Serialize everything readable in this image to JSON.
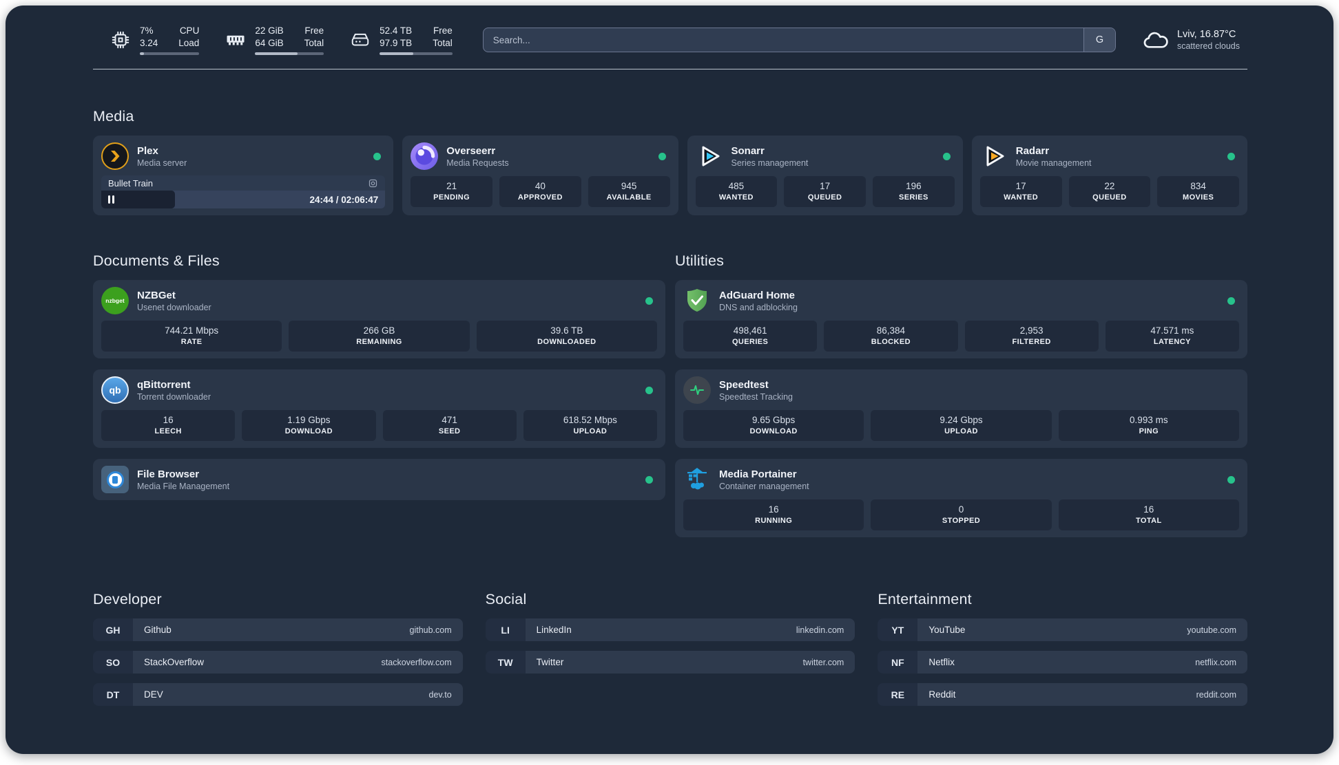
{
  "system": {
    "cpu": {
      "value_top": "7%",
      "value_bottom": "3.24",
      "label_top": "CPU",
      "label_bottom": "Load",
      "progress_pct": 7
    },
    "memory": {
      "value_top": "22 GiB",
      "value_bottom": "64 GiB",
      "label_top": "Free",
      "label_bottom": "Total",
      "progress_pct": 62
    },
    "disk": {
      "value_top": "52.4 TB",
      "value_bottom": "97.9 TB",
      "label_top": "Free",
      "label_bottom": "Total",
      "progress_pct": 46
    }
  },
  "search": {
    "placeholder": "Search...",
    "engine_button": "G"
  },
  "weather": {
    "location": "Lviv, 16.87°C",
    "condition": "scattered clouds"
  },
  "colors": {
    "online_dot": "#27c28b"
  },
  "sections": {
    "media": {
      "title": "Media",
      "plex": {
        "name": "Plex",
        "subtitle": "Media server",
        "icon": "plex-icon",
        "now_playing": {
          "title": "Bullet Train",
          "time_display": "24:44 / 02:06:47",
          "progress_pct": 26
        }
      },
      "overseerr": {
        "name": "Overseerr",
        "subtitle": "Media Requests",
        "icon": "overseerr-icon",
        "stats": [
          {
            "value": "21",
            "label": "PENDING"
          },
          {
            "value": "40",
            "label": "APPROVED"
          },
          {
            "value": "945",
            "label": "AVAILABLE"
          }
        ]
      },
      "sonarr": {
        "name": "Sonarr",
        "subtitle": "Series management",
        "icon": "sonarr-icon",
        "stats": [
          {
            "value": "485",
            "label": "WANTED"
          },
          {
            "value": "17",
            "label": "QUEUED"
          },
          {
            "value": "196",
            "label": "SERIES"
          }
        ]
      },
      "radarr": {
        "name": "Radarr",
        "subtitle": "Movie management",
        "icon": "radarr-icon",
        "stats": [
          {
            "value": "17",
            "label": "WANTED"
          },
          {
            "value": "22",
            "label": "QUEUED"
          },
          {
            "value": "834",
            "label": "MOVIES"
          }
        ]
      }
    },
    "documents": {
      "title": "Documents & Files",
      "nzbget": {
        "name": "NZBGet",
        "subtitle": "Usenet downloader",
        "icon": "nzbget-icon",
        "stats": [
          {
            "value": "744.21 Mbps",
            "label": "RATE"
          },
          {
            "value": "266 GB",
            "label": "REMAINING"
          },
          {
            "value": "39.6 TB",
            "label": "DOWNLOADED"
          }
        ]
      },
      "qbittorrent": {
        "name": "qBittorrent",
        "subtitle": "Torrent downloader",
        "icon": "qbittorrent-icon",
        "stats": [
          {
            "value": "16",
            "label": "LEECH"
          },
          {
            "value": "1.19 Gbps",
            "label": "DOWNLOAD"
          },
          {
            "value": "471",
            "label": "SEED"
          },
          {
            "value": "618.52 Mbps",
            "label": "UPLOAD"
          }
        ]
      },
      "filebrowser": {
        "name": "File Browser",
        "subtitle": "Media File Management",
        "icon": "filebrowser-icon"
      }
    },
    "utilities": {
      "title": "Utilities",
      "adguard": {
        "name": "AdGuard Home",
        "subtitle": "DNS and adblocking",
        "icon": "adguard-icon",
        "stats": [
          {
            "value": "498,461",
            "label": "QUERIES"
          },
          {
            "value": "86,384",
            "label": "BLOCKED"
          },
          {
            "value": "2,953",
            "label": "FILTERED"
          },
          {
            "value": "47.571 ms",
            "label": "LATENCY"
          }
        ]
      },
      "speedtest": {
        "name": "Speedtest",
        "subtitle": "Speedtest Tracking",
        "icon": "speedtest-icon",
        "stats": [
          {
            "value": "9.65 Gbps",
            "label": "DOWNLOAD"
          },
          {
            "value": "9.24 Gbps",
            "label": "UPLOAD"
          },
          {
            "value": "0.993 ms",
            "label": "PING"
          }
        ]
      },
      "portainer": {
        "name": "Media Portainer",
        "subtitle": "Container management",
        "icon": "portainer-icon",
        "stats": [
          {
            "value": "16",
            "label": "RUNNING"
          },
          {
            "value": "0",
            "label": "STOPPED"
          },
          {
            "value": "16",
            "label": "TOTAL"
          }
        ]
      }
    },
    "developer": {
      "title": "Developer",
      "links": [
        {
          "abbr": "GH",
          "name": "Github",
          "url": "github.com"
        },
        {
          "abbr": "SO",
          "name": "StackOverflow",
          "url": "stackoverflow.com"
        },
        {
          "abbr": "DT",
          "name": "DEV",
          "url": "dev.to"
        }
      ]
    },
    "social": {
      "title": "Social",
      "links": [
        {
          "abbr": "LI",
          "name": "LinkedIn",
          "url": "linkedin.com"
        },
        {
          "abbr": "TW",
          "name": "Twitter",
          "url": "twitter.com"
        }
      ]
    },
    "entertainment": {
      "title": "Entertainment",
      "links": [
        {
          "abbr": "YT",
          "name": "YouTube",
          "url": "youtube.com"
        },
        {
          "abbr": "NF",
          "name": "Netflix",
          "url": "netflix.com"
        },
        {
          "abbr": "RE",
          "name": "Reddit",
          "url": "reddit.com"
        }
      ]
    }
  }
}
